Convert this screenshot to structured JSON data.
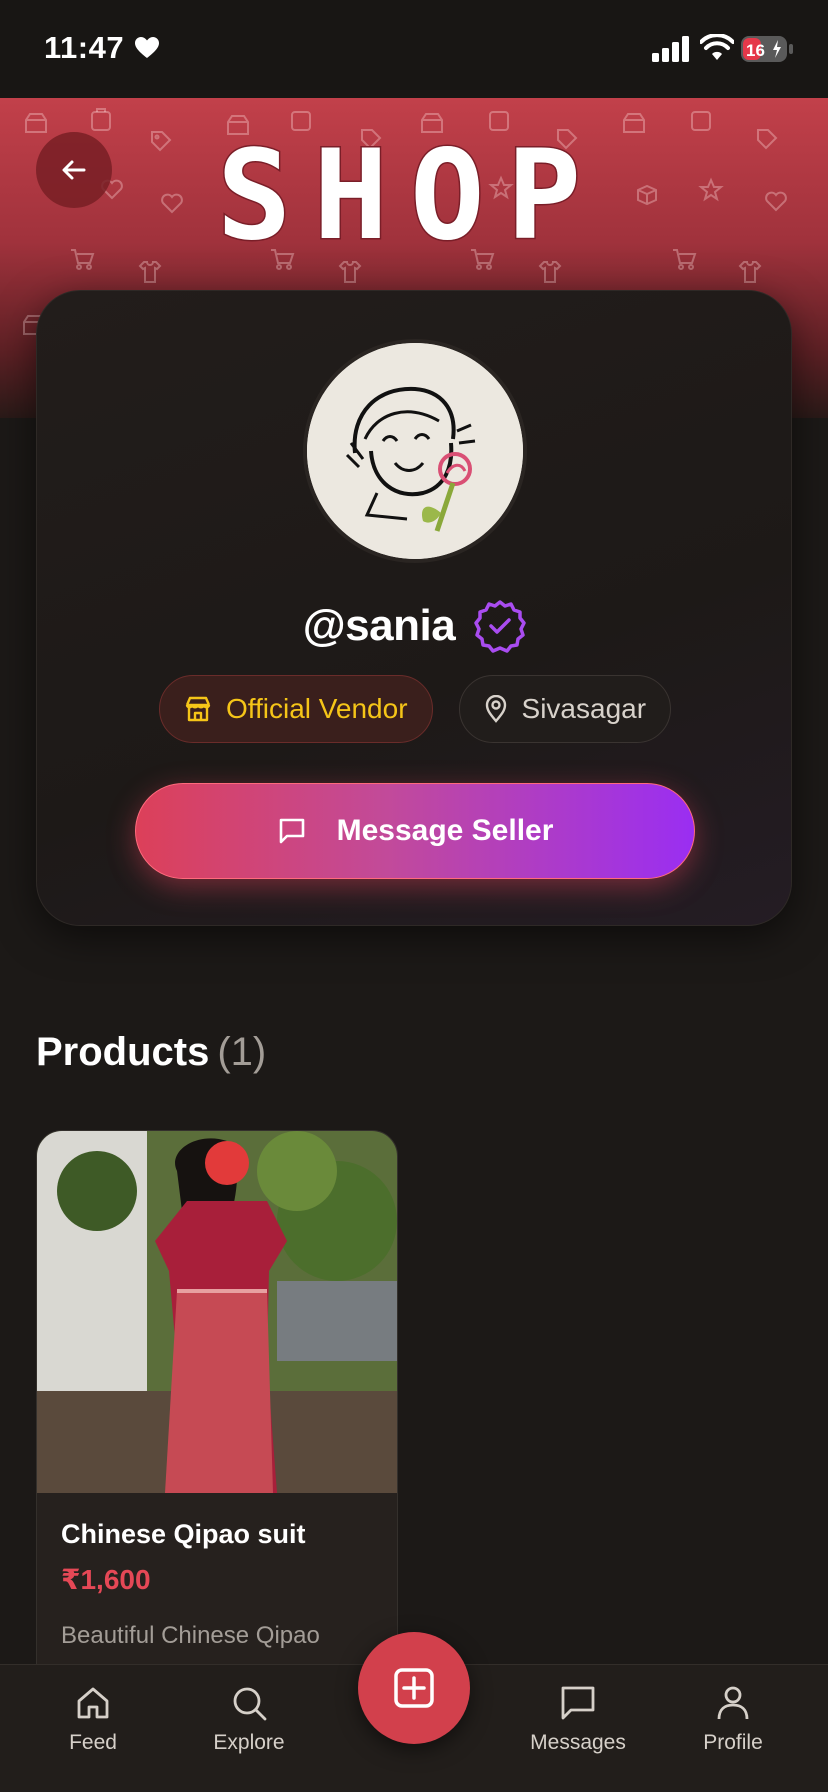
{
  "status_bar": {
    "time": "11:47",
    "battery": "16"
  },
  "header": {
    "title": "SHOP",
    "back_icon": "arrow-left-icon"
  },
  "profile": {
    "username": "@sania",
    "verified_icon": "verified-badge-icon",
    "vendor_badge": "Official Vendor",
    "location": "Sivasagar",
    "message_button": "Message Seller"
  },
  "products": {
    "heading": "Products",
    "count": "(1)",
    "items": [
      {
        "title": "Chinese Qipao suit",
        "price": "₹1,600",
        "description": "Beautiful Chinese Qipao"
      }
    ]
  },
  "nav": {
    "items": [
      {
        "label": "Feed",
        "icon": "home-icon"
      },
      {
        "label": "Explore",
        "icon": "search-icon"
      },
      {
        "label": "Messages",
        "icon": "message-icon"
      },
      {
        "label": "Profile",
        "icon": "user-icon"
      }
    ],
    "fab_icon": "plus-square-icon"
  },
  "colors": {
    "accent": "#d2404c",
    "vendor": "#f5c518",
    "verified": "#a94cf0",
    "price": "#e54856"
  }
}
